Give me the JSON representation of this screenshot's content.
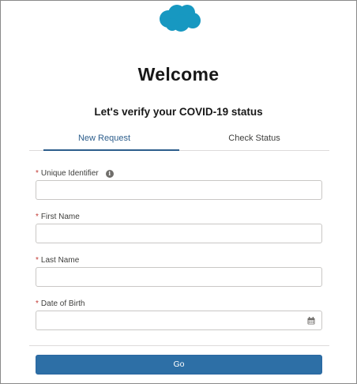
{
  "header": {
    "logo_icon": "salesforce-cloud-icon",
    "logo_color": "#1798c1",
    "title": "Welcome",
    "subtitle": "Let's verify your COVID-19 status"
  },
  "tabs": [
    {
      "label": "New Request",
      "active": true
    },
    {
      "label": "Check Status",
      "active": false
    }
  ],
  "form": {
    "required_marker": "*",
    "unique_identifier": {
      "label": "Unique Identifier",
      "value": "",
      "info_icon": "info-icon"
    },
    "first_name": {
      "label": "First Name",
      "value": ""
    },
    "last_name": {
      "label": "Last Name",
      "value": ""
    },
    "date_of_birth": {
      "label": "Date of Birth",
      "value": "",
      "icon": "calendar-icon"
    },
    "submit_label": "Go"
  },
  "colors": {
    "accent": "#2d5e8c",
    "button": "#2d6fa6",
    "required": "#c23934"
  }
}
